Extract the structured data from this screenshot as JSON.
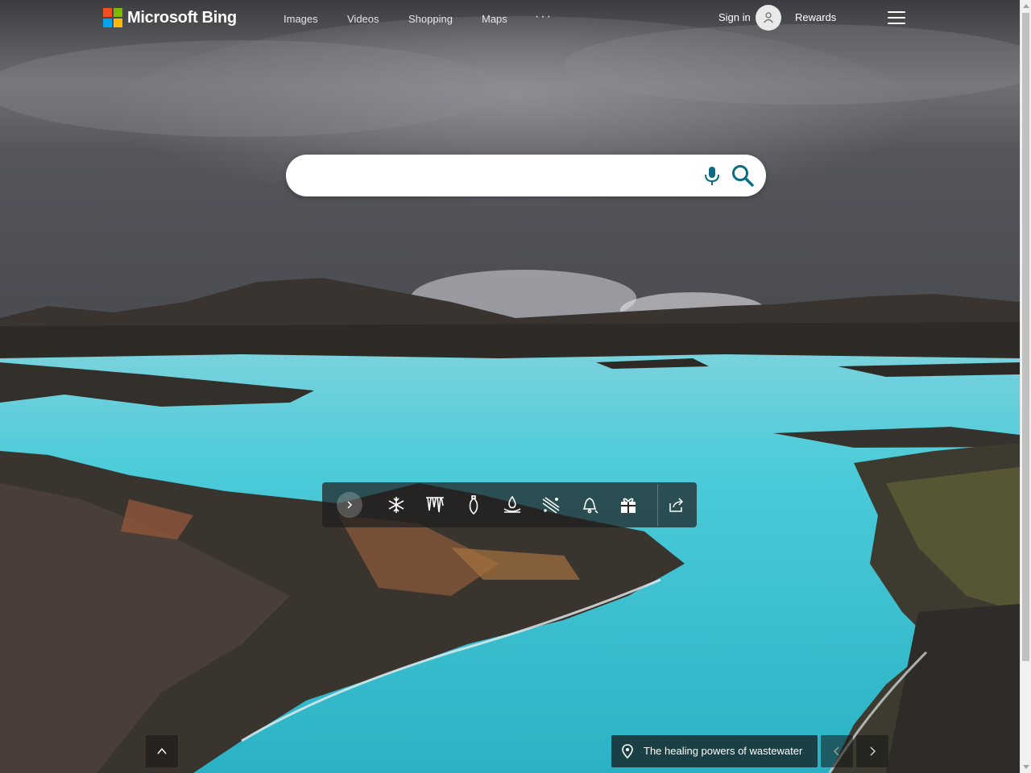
{
  "brand": {
    "name": "Microsoft Bing"
  },
  "header": {
    "nav": [
      {
        "label": "Images"
      },
      {
        "label": "Videos"
      },
      {
        "label": "Shopping"
      },
      {
        "label": "Maps"
      },
      {
        "label": "···"
      }
    ],
    "sign_in": "Sign in",
    "rewards": "Rewards"
  },
  "search": {
    "value": "",
    "placeholder": ""
  },
  "toolbar": {
    "icons": [
      "chevron-right-icon",
      "snowflake-icon",
      "icicles-icon",
      "ornament-icon",
      "campfire-icon",
      "snowy-slope-icon",
      "bell-icon",
      "gift-icon",
      "share-icon"
    ]
  },
  "caption": {
    "text": "The healing powers of wastewater"
  },
  "colors": {
    "accent": "#0c6c84",
    "pane": "#1e1e1e"
  }
}
